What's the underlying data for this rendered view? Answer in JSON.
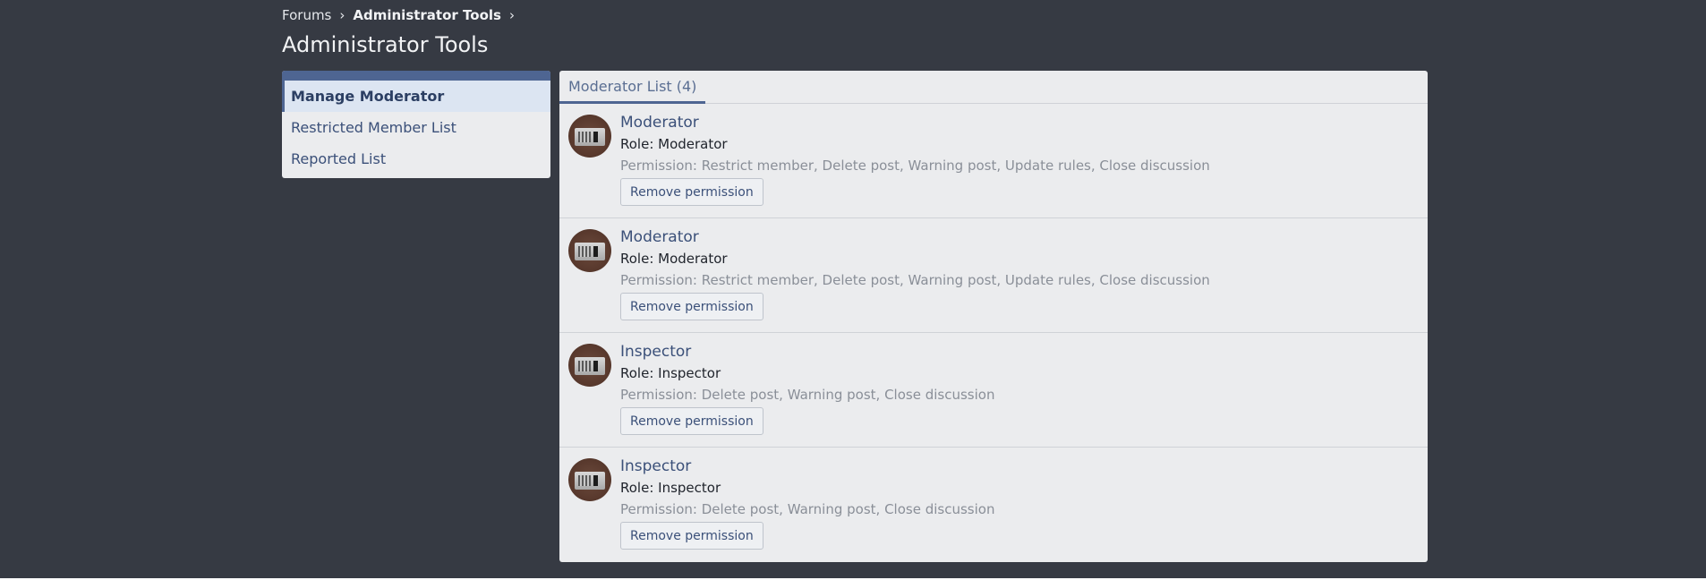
{
  "breadcrumb": {
    "items": [
      "Forums",
      "Administrator Tools"
    ],
    "separator": "›"
  },
  "page": {
    "title": "Administrator Tools"
  },
  "sidebar": {
    "items": [
      {
        "label": "Manage Moderator",
        "active": true
      },
      {
        "label": "Restricted Member List",
        "active": false
      },
      {
        "label": "Reported List",
        "active": false
      }
    ]
  },
  "main": {
    "tab_label": "Moderator List (4)",
    "moderators": [
      {
        "name": "Moderator",
        "role": "Role: Moderator",
        "permission": "Permission: Restrict member, Delete post, Warning post, Update rules, Close discussion",
        "button": "Remove permission"
      },
      {
        "name": "Moderator",
        "role": "Role: Moderator",
        "permission": "Permission: Restrict member, Delete post, Warning post, Update rules, Close discussion",
        "button": "Remove permission"
      },
      {
        "name": "Inspector",
        "role": "Role: Inspector",
        "permission": "Permission: Delete post, Warning post, Close discussion",
        "button": "Remove permission"
      },
      {
        "name": "Inspector",
        "role": "Role: Inspector",
        "permission": "Permission: Delete post, Warning post, Close discussion",
        "button": "Remove permission"
      }
    ]
  },
  "colors": {
    "page_background": "#363a43",
    "panel_background": "#ebecee",
    "accent": "#4e6592",
    "link": "#3b5079",
    "muted_text": "#8a8f98"
  },
  "icons": {
    "breadcrumb_separator": "chevron-right-icon",
    "avatar": "user-avatar-image"
  }
}
